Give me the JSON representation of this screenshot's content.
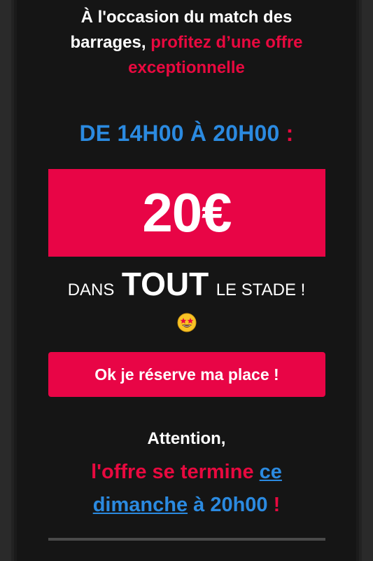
{
  "intro": {
    "white": "À l'occasion du match des barrages,",
    "pink": "profitez d’une offre exceptionnelle"
  },
  "hours": {
    "text": "DE 14H00 À 20H00",
    "colon": ":"
  },
  "price": "20€",
  "scope": {
    "before": "DANS",
    "emphasis": "TOUT",
    "after": "LE STADE !"
  },
  "emoji_icon": "star-struck-emoji-icon",
  "cta_label": "Ok je réserve ma place !",
  "notice": {
    "attention": "Attention,",
    "offer_text": "l'offre se termine",
    "link_text": "ce dimanche",
    "time_text": "à 20h00",
    "exclamation": "!"
  },
  "colors": {
    "background": "#151515",
    "accent_pink": "#e80546",
    "accent_blue": "#2b8ae0",
    "text": "#ffffff"
  }
}
